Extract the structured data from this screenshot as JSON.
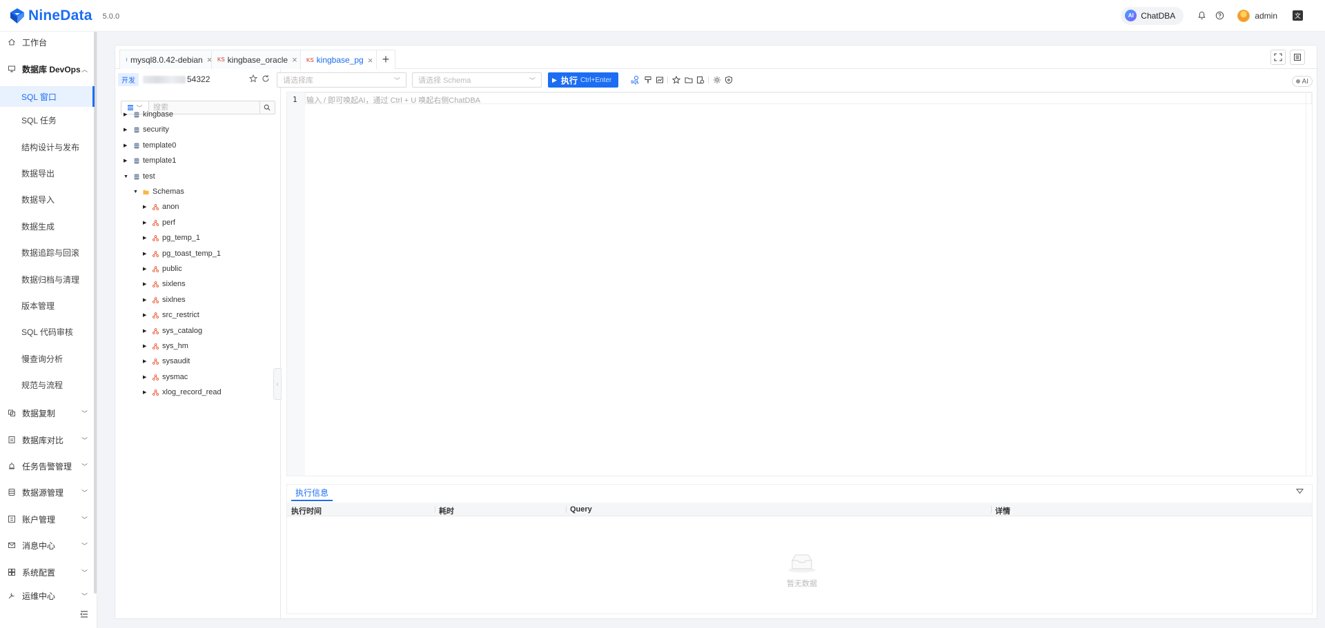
{
  "header": {
    "logo_text": "NineData",
    "version": "5.0.0",
    "chatdba_badge": "AI",
    "chatdba_label": "ChatDBA",
    "username": "admin",
    "lang_icon": "文",
    "accent_color": "#1c6df2"
  },
  "sidebar": {
    "items": [
      {
        "label": "工作台",
        "icon": "home-icon"
      },
      {
        "label": "数据库 DevOps",
        "icon": "devops-icon",
        "expanded": true
      },
      {
        "label": "数据复制",
        "icon": "replication-icon"
      },
      {
        "label": "数据库对比",
        "icon": "compare-icon"
      },
      {
        "label": "任务告警管理",
        "icon": "alert-icon"
      },
      {
        "label": "数据源管理",
        "icon": "datasource-icon"
      },
      {
        "label": "账户管理",
        "icon": "account-icon"
      },
      {
        "label": "消息中心",
        "icon": "message-icon"
      },
      {
        "label": "系统配置",
        "icon": "settings-grid-icon"
      },
      {
        "label": "运维中心",
        "icon": "ops-icon"
      }
    ],
    "devops_subitems": [
      "SQL 窗口",
      "SQL 任务",
      "结构设计与发布",
      "数据导出",
      "数据导入",
      "数据生成",
      "数据追踪与回滚",
      "数据归档与清理",
      "版本管理",
      "SQL 代码审核",
      "慢查询分析",
      "规范与流程"
    ],
    "active_subitem": "SQL 窗口"
  },
  "tabs": [
    {
      "label": "mysql8.0.42-debian",
      "icon": "mysql-icon",
      "active": false
    },
    {
      "label": "kingbase_oracle",
      "icon": "kingbase-icon",
      "active": false
    },
    {
      "label": "kingbase_pg",
      "icon": "kingbase-icon",
      "active": true
    }
  ],
  "tab_close": "×",
  "tab_add": "+",
  "connection": {
    "env_tag": "开发",
    "name_visible": "54322"
  },
  "search": {
    "placeholder": "搜索"
  },
  "tree": [
    {
      "label": "kingbase",
      "level": 0,
      "type": "database",
      "expanded": false
    },
    {
      "label": "security",
      "level": 0,
      "type": "database",
      "expanded": false
    },
    {
      "label": "template0",
      "level": 0,
      "type": "database",
      "expanded": false
    },
    {
      "label": "template1",
      "level": 0,
      "type": "database",
      "expanded": false
    },
    {
      "label": "test",
      "level": 0,
      "type": "database",
      "expanded": true
    },
    {
      "label": "Schemas",
      "level": 1,
      "type": "folder",
      "expanded": true
    },
    {
      "label": "anon",
      "level": 2,
      "type": "schema",
      "expanded": false
    },
    {
      "label": "perf",
      "level": 2,
      "type": "schema",
      "expanded": false
    },
    {
      "label": "pg_temp_1",
      "level": 2,
      "type": "schema",
      "expanded": false
    },
    {
      "label": "pg_toast_temp_1",
      "level": 2,
      "type": "schema",
      "expanded": false
    },
    {
      "label": "public",
      "level": 2,
      "type": "schema",
      "expanded": false
    },
    {
      "label": "sixlens",
      "level": 2,
      "type": "schema",
      "expanded": false
    },
    {
      "label": "sixlnes",
      "level": 2,
      "type": "schema",
      "expanded": false
    },
    {
      "label": "src_restrict",
      "level": 2,
      "type": "schema",
      "expanded": false
    },
    {
      "label": "sys_catalog",
      "level": 2,
      "type": "schema",
      "expanded": false
    },
    {
      "label": "sys_hm",
      "level": 2,
      "type": "schema",
      "expanded": false
    },
    {
      "label": "sysaudit",
      "level": 2,
      "type": "schema",
      "expanded": false
    },
    {
      "label": "sysmac",
      "level": 2,
      "type": "schema",
      "expanded": false
    },
    {
      "label": "xlog_record_read",
      "level": 2,
      "type": "schema",
      "expanded": false
    }
  ],
  "toolbar": {
    "db_select_placeholder": "请选择库",
    "schema_select_placeholder": "请选择 Schema",
    "run_label": "执行",
    "run_shortcut": "Ctrl+Enter",
    "ai_toggle_label": "AI"
  },
  "editor": {
    "line_number": "1",
    "placeholder": "输入 / 即可唤起AI，通过 Ctrl + U 唤起右侧ChatDBA"
  },
  "result": {
    "tab_label": "执行信息",
    "columns": [
      "执行时间",
      "耗时",
      "Query",
      "详情"
    ],
    "empty_text": "暂无数据"
  }
}
